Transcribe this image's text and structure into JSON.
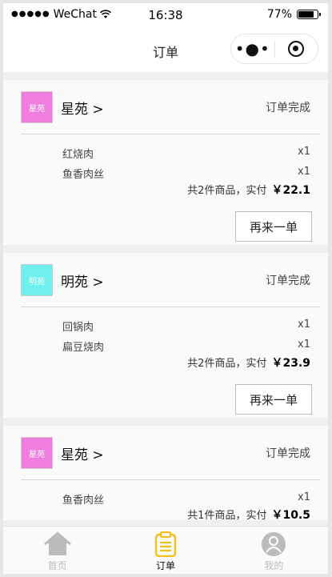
{
  "status_bar": {
    "signal_dots": "●●●●●",
    "carrier": "WeChat",
    "time": "16:38",
    "battery_percent": "77%"
  },
  "nav": {
    "title": "订单",
    "more_glyph": "•●•"
  },
  "orders": [
    {
      "logo_text": "星苑",
      "logo_color": "#f07ee0",
      "shop_name": "星苑 >",
      "status": "订单完成",
      "items": [
        {
          "name": "红烧肉",
          "qty": "x1"
        },
        {
          "name": "鱼香肉丝",
          "qty": "x1"
        }
      ],
      "summary_text": "共2件商品，实付",
      "total": "￥22.1",
      "reorder_label": "再来一单"
    },
    {
      "logo_text": "明苑",
      "logo_color": "#6ff0ee",
      "shop_name": "明苑 >",
      "status": "订单完成",
      "items": [
        {
          "name": "回锅肉",
          "qty": "x1"
        },
        {
          "name": "扁豆烧肉",
          "qty": "x1"
        }
      ],
      "summary_text": "共2件商品，实付",
      "total": "￥23.9",
      "reorder_label": "再来一单"
    },
    {
      "logo_text": "星苑",
      "logo_color": "#f07ee0",
      "shop_name": "星苑 >",
      "status": "订单完成",
      "items": [
        {
          "name": "鱼香肉丝",
          "qty": "x1"
        }
      ],
      "summary_text": "共1件商品，实付",
      "total": "￥10.5"
    }
  ],
  "tabs": [
    {
      "label": "首页",
      "icon": "home-icon",
      "active": false
    },
    {
      "label": "订单",
      "icon": "orders-clipboard-icon",
      "active": true
    },
    {
      "label": "我的",
      "icon": "profile-icon",
      "active": false
    }
  ],
  "colors": {
    "active_tab_icon": "#f2c01a",
    "inactive_tab_icon": "#bbbbbb"
  }
}
